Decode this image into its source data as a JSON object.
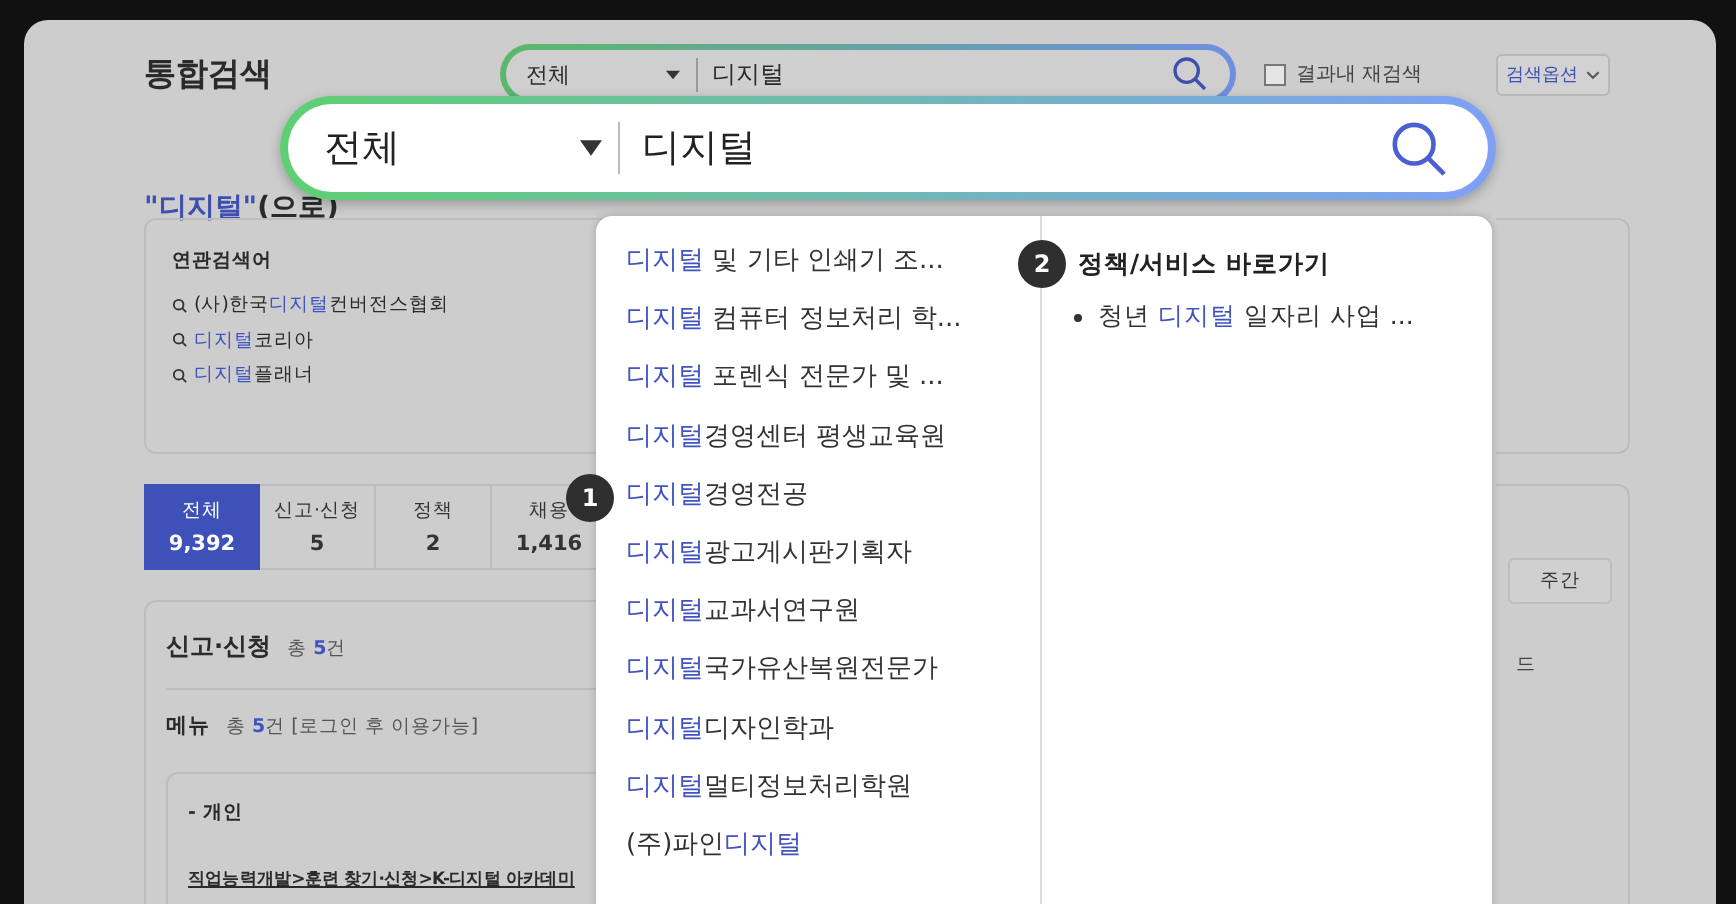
{
  "header": {
    "title": "통합검색",
    "search": {
      "scope": "전체",
      "query": "디지털"
    },
    "refine": {
      "label": "결과내 재검색",
      "checked": false
    },
    "options_button": "검색옵션"
  },
  "magnified_search": {
    "scope": "전체",
    "query": "디지털"
  },
  "result_heading": {
    "query": "\"디지털\"",
    "suffix": "(으로)"
  },
  "related": {
    "title": "연관검색어",
    "items": [
      [
        {
          "text": "(사)한국",
          "match": false
        },
        {
          "text": "디지털",
          "match": true
        },
        {
          "text": "컨버전스협회",
          "match": false
        }
      ],
      [
        {
          "text": "디지털",
          "match": true
        },
        {
          "text": "코리아",
          "match": false
        }
      ],
      [
        {
          "text": "디지털",
          "match": true
        },
        {
          "text": "플래너",
          "match": false
        }
      ]
    ]
  },
  "tabs": [
    {
      "label": "전체",
      "count": "9,392",
      "selected": true
    },
    {
      "label": "신고·신청",
      "count": "5",
      "selected": false
    },
    {
      "label": "정책",
      "count": "2",
      "selected": false
    },
    {
      "label": "채용",
      "count": "1,416",
      "selected": false
    }
  ],
  "section": {
    "title": "신고·신청",
    "total": [
      {
        "text": "총 ",
        "match": false
      },
      {
        "text": "5",
        "match": true
      },
      {
        "text": "건",
        "match": false
      }
    ],
    "menu_title": "메뉴",
    "menu_total": [
      {
        "text": "총 ",
        "match": false
      },
      {
        "text": "5",
        "match": true
      },
      {
        "text": "건 [로그인 후 이용가능]",
        "match": false
      }
    ],
    "group": "- 개인",
    "link": "직업능력개발>훈련 찾기·신청>K-디지털 아카데미"
  },
  "sidebar": {
    "period_button": "주간",
    "fragment": "드"
  },
  "suggestions": {
    "marker": "1",
    "items": [
      [
        {
          "text": "디지털",
          "match": true
        },
        {
          "text": " 및 기타 인쇄기 조...",
          "match": false
        }
      ],
      [
        {
          "text": "디지털",
          "match": true
        },
        {
          "text": " 컴퓨터 정보처리 학...",
          "match": false
        }
      ],
      [
        {
          "text": "디지털",
          "match": true
        },
        {
          "text": " 포렌식 전문가 및 ...",
          "match": false
        }
      ],
      [
        {
          "text": "디지털",
          "match": true
        },
        {
          "text": "경영센터 평생교육원",
          "match": false
        }
      ],
      [
        {
          "text": "디지털",
          "match": true
        },
        {
          "text": "경영전공",
          "match": false
        }
      ],
      [
        {
          "text": "디지털",
          "match": true
        },
        {
          "text": "광고게시판기획자",
          "match": false
        }
      ],
      [
        {
          "text": "디지털",
          "match": true
        },
        {
          "text": "교과서연구원",
          "match": false
        }
      ],
      [
        {
          "text": "디지털",
          "match": true
        },
        {
          "text": "국가유산복원전문가",
          "match": false
        }
      ],
      [
        {
          "text": "디지털",
          "match": true
        },
        {
          "text": "디자인학과",
          "match": false
        }
      ],
      [
        {
          "text": "디지털",
          "match": true
        },
        {
          "text": "멀티정보처리학원",
          "match": false
        }
      ],
      [
        {
          "text": "(주)파인",
          "match": false
        },
        {
          "text": "디지털",
          "match": true
        }
      ]
    ],
    "shortcut_marker": "2",
    "shortcut_title": "정책/서비스 바로가기",
    "shortcuts": [
      [
        {
          "text": "청년 ",
          "match": false
        },
        {
          "text": "디지털",
          "match": true
        },
        {
          "text": " 일자리 사업 ...",
          "match": false
        }
      ]
    ]
  }
}
